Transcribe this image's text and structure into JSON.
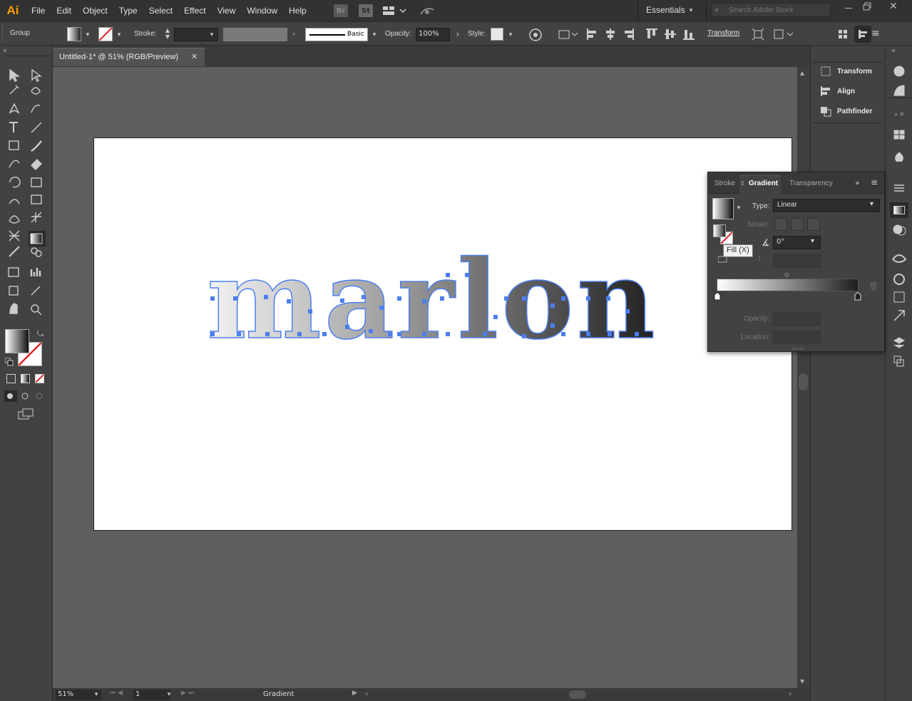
{
  "app": {
    "logo": "Ai"
  },
  "menu": [
    "File",
    "Edit",
    "Object",
    "Type",
    "Select",
    "Effect",
    "View",
    "Window",
    "Help"
  ],
  "menubar": {
    "bridge_label": "Br",
    "stock_label": "St",
    "workspace": "Essentials",
    "search_placeholder": "Search Adobe Stock"
  },
  "control": {
    "selection_type": "Group",
    "stroke_label": "Stroke:",
    "brush_label": "Basic",
    "opacity_label": "Opacity:",
    "opacity_value": "100%",
    "style_label": "Style:",
    "transform_label": "Transform"
  },
  "document": {
    "tab_title": "Untitled-1* @ 51% (RGB/Preview)",
    "artwork_text": "marlon"
  },
  "status": {
    "zoom": "51%",
    "artboard_number": "1",
    "current_tool": "Gradient"
  },
  "panels": {
    "transform": "Transform",
    "align": "Align",
    "pathfinder": "Pathfinder"
  },
  "gradient_panel": {
    "tabs": [
      "Stroke",
      "Gradient",
      "Transparency"
    ],
    "type_label": "Type:",
    "type_value": "Linear",
    "stroke_label": "Stroke:",
    "angle_value": "0°",
    "opacity_label": "Opacity:",
    "location_label": "Location:",
    "tooltip": "Fill (X)"
  },
  "colors": {
    "accent": "#4b7ff0",
    "menubar": "#323232",
    "panel": "#424242",
    "canvas": "#5f5f5f"
  }
}
